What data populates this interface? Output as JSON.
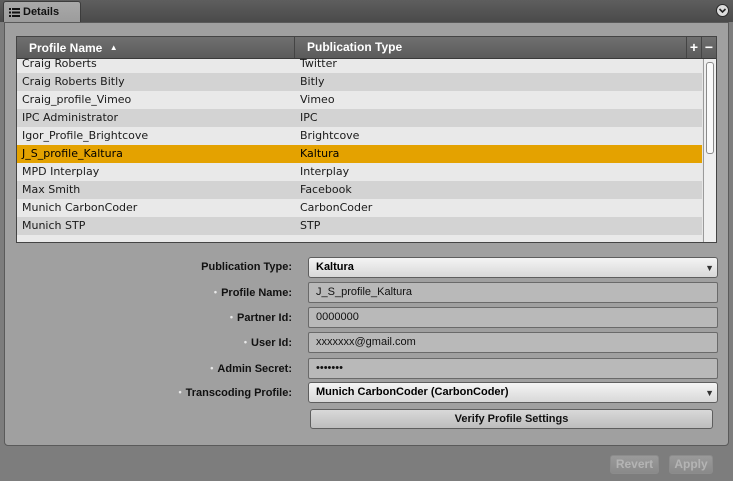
{
  "tab": {
    "label": "Details"
  },
  "table": {
    "columns": [
      "Profile Name",
      "Publication Type"
    ],
    "sort_indicator": "▲",
    "add_label": "+",
    "remove_label": "−",
    "rows": [
      {
        "name": "Craig Roberts",
        "type": "Twitter"
      },
      {
        "name": "Craig Roberts Bitly",
        "type": "Bitly"
      },
      {
        "name": "Craig_profile_Vimeo",
        "type": "Vimeo"
      },
      {
        "name": "IPC Administrator",
        "type": "IPC"
      },
      {
        "name": "Igor_Profile_Brightcove",
        "type": "Brightcove"
      },
      {
        "name": "J_S_profile_Kaltura",
        "type": "Kaltura"
      },
      {
        "name": "MPD Interplay",
        "type": "Interplay"
      },
      {
        "name": "Max Smith",
        "type": "Facebook"
      },
      {
        "name": "Munich CarbonCoder",
        "type": "CarbonCoder"
      },
      {
        "name": "Munich STP",
        "type": "STP"
      },
      {
        "name": "",
        "type": ""
      }
    ],
    "selected_index": 5
  },
  "form": {
    "publication_type": {
      "label": "Publication Type:",
      "value": "Kaltura"
    },
    "profile_name": {
      "label": "Profile Name:",
      "value": "J_S_profile_Kaltura"
    },
    "partner_id": {
      "label": "Partner Id:",
      "value": "0000000"
    },
    "user_id": {
      "label": "User Id:",
      "value": "xxxxxxx@gmail.com"
    },
    "admin_secret": {
      "label": "Admin Secret:",
      "value": "•••••••"
    },
    "transcoding_profile": {
      "label": "Transcoding Profile:",
      "value": "Munich CarbonCoder (CarbonCoder)"
    },
    "required_marker": "•",
    "verify_label": "Verify Profile Settings"
  },
  "footer": {
    "revert_label": "Revert",
    "apply_label": "Apply"
  },
  "colors": {
    "selected_row": "#e4a200",
    "header": "#626262",
    "panel": "#a0a0a0"
  },
  "icons": {
    "tab": "list-icon",
    "panel_menu": "panel-menu-icon",
    "dropdown": "chevron-down-icon"
  }
}
